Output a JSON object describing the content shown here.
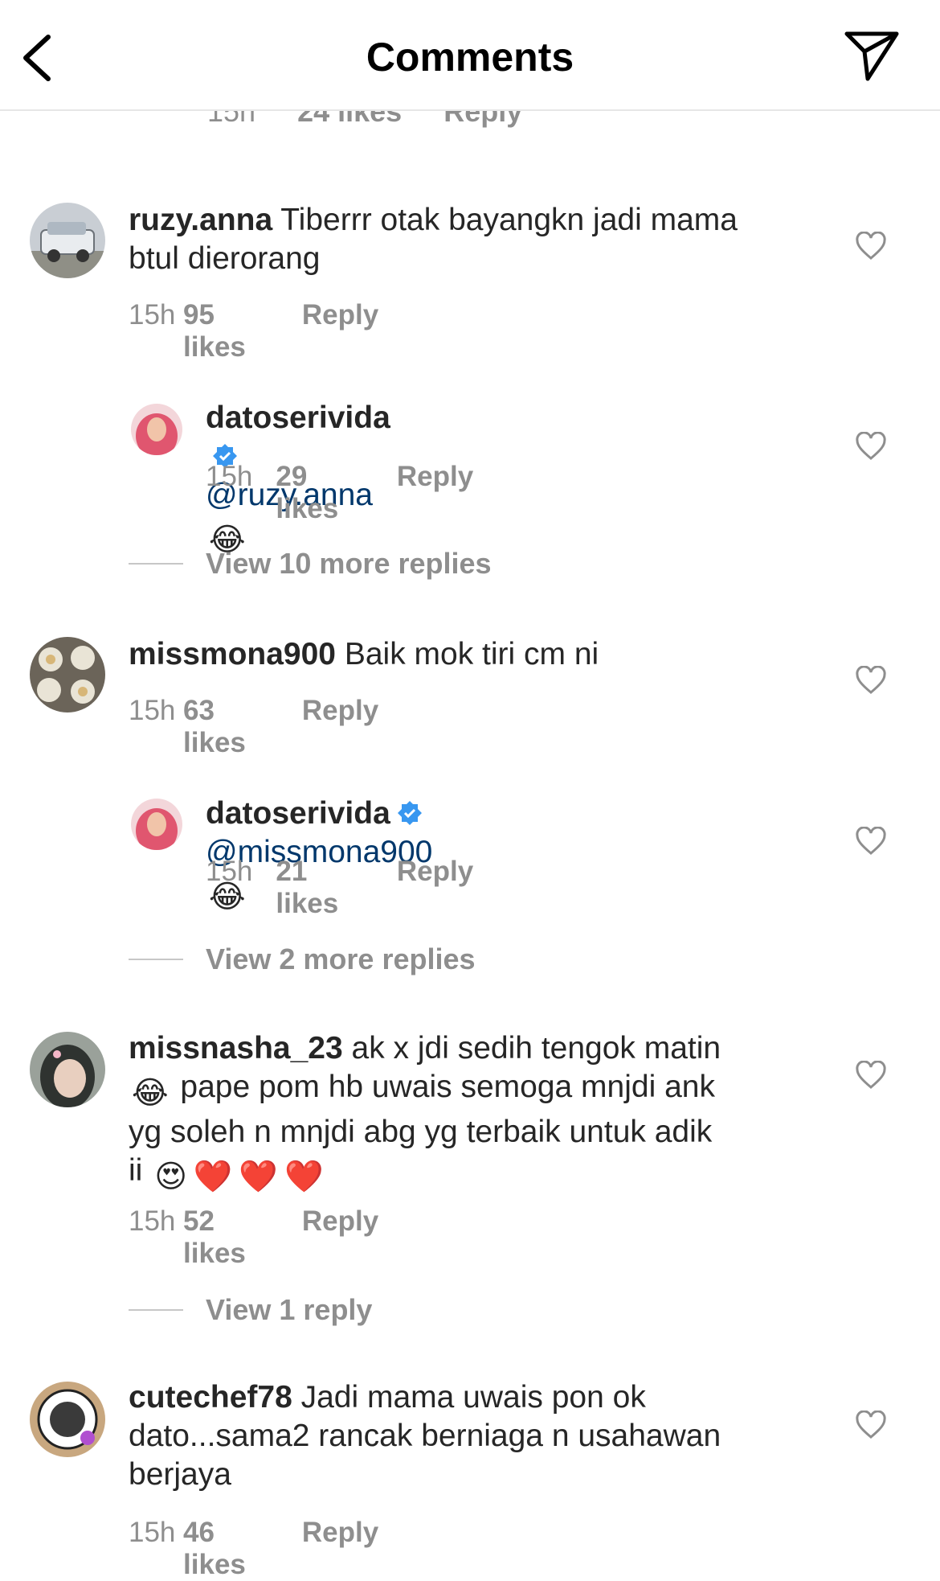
{
  "header": {
    "title": "Comments",
    "back_icon": "chevron-left-icon",
    "send_icon": "paper-plane-icon"
  },
  "partial_previous": {
    "time": "15h",
    "likes": "24 likes",
    "reply": "Reply"
  },
  "comments": [
    {
      "username": "ruzy.anna",
      "text_line1": "Tiberrr otak bayangkn jadi mama",
      "text_line2": "btul dierorang",
      "time": "15h",
      "likes": "95 likes",
      "reply": "Reply",
      "replies": [
        {
          "username": "datoserivida",
          "mention": "@ruzy.anna",
          "emoji": "😂",
          "time": "15h",
          "likes": "29 likes",
          "reply": "Reply"
        }
      ],
      "view_more": "View 10 more replies"
    },
    {
      "username": "missmona900",
      "text_line1": "Baik mok tiri cm ni",
      "time": "15h",
      "likes": "63 likes",
      "reply": "Reply",
      "replies": [
        {
          "username": "datoserivida",
          "mention": "@missmona900",
          "emoji": "😂",
          "time": "15h",
          "likes": "21 likes",
          "reply": "Reply"
        }
      ],
      "view_more": "View 2 more replies"
    },
    {
      "username": "missnasha_23",
      "text_line1": "ak x jdi sedih tengok matin",
      "text_line2": "pape pom hb uwais semoga mnjdi ank",
      "text_line3": "yg soleh n mnjdi abg yg terbaik untuk adik",
      "text_line4": "ii",
      "emoji_laugh": "😂",
      "emoji_heart_eyes": "😍",
      "emoji_heart": "❤️",
      "time": "15h",
      "likes": "52 likes",
      "reply": "Reply",
      "view_more": "View 1 reply"
    },
    {
      "username": "cutechef78",
      "text_line1": "Jadi mama uwais pon ok",
      "text_line2": "dato...sama2 rancak berniaga n usahawan",
      "text_line3": "berjaya",
      "time": "15h",
      "likes": "46 likes",
      "reply": "Reply"
    }
  ],
  "colors": {
    "text": "#262626",
    "muted": "#8e8e8e",
    "mention": "#00376b",
    "verified": "#3897f0"
  }
}
